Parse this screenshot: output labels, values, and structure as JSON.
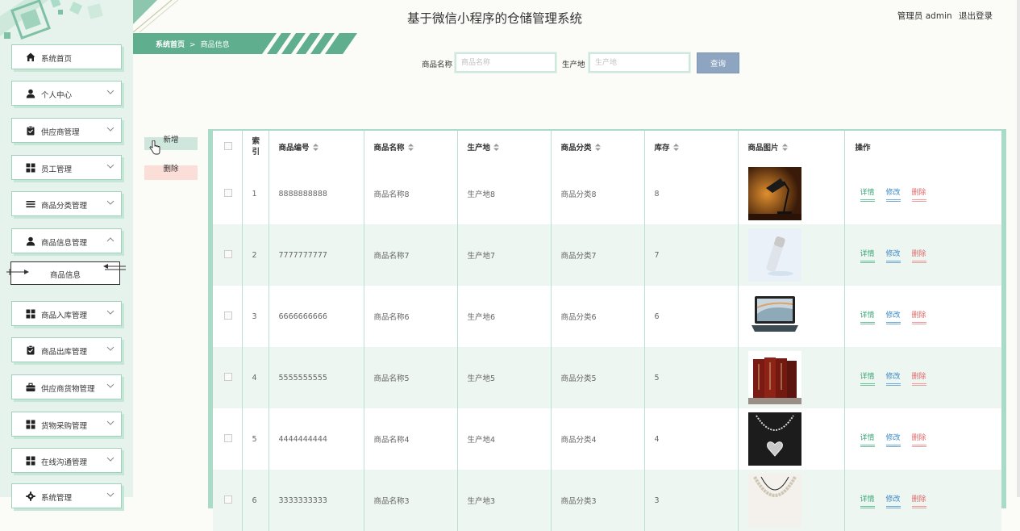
{
  "app": {
    "title": "基于微信小程序的仓储管理系统",
    "user_label": "管理员 admin",
    "logout_label": "退出登录"
  },
  "breadcrumb": {
    "home": "系统首页",
    "separator": ">",
    "current": "商品信息"
  },
  "sidebar": {
    "items": [
      {
        "label": "系统首页",
        "icon": "home-icon"
      },
      {
        "label": "个人中心",
        "icon": "user-icon"
      },
      {
        "label": "供应商管理",
        "icon": "clipboard-icon"
      },
      {
        "label": "员工管理",
        "icon": "grid-icon"
      },
      {
        "label": "商品分类管理",
        "icon": "list-icon"
      },
      {
        "label": "商品信息管理",
        "icon": "user-icon"
      },
      {
        "label": "商品入库管理",
        "icon": "grid-icon"
      },
      {
        "label": "商品出库管理",
        "icon": "clipboard-icon"
      },
      {
        "label": "供应商货物管理",
        "icon": "briefcase-icon"
      },
      {
        "label": "货物采购管理",
        "icon": "grid-icon"
      },
      {
        "label": "在线沟通管理",
        "icon": "grid-icon"
      },
      {
        "label": "系统管理",
        "icon": "gear-icon"
      }
    ],
    "subitem": {
      "label": "商品信息"
    }
  },
  "search": {
    "name_label": "商品名称",
    "name_placeholder": "商品名称",
    "origin_label": "生产地",
    "origin_placeholder": "生产地",
    "button_label": "查询"
  },
  "actions": {
    "add_label": "新增",
    "delete_label": "删除"
  },
  "table": {
    "headers": {
      "index": "索引",
      "code": "商品编号",
      "name": "商品名称",
      "origin": "生产地",
      "category": "商品分类",
      "stock": "库存",
      "image": "商品图片",
      "ops": "操作"
    },
    "row_actions": {
      "detail": "详情",
      "edit": "修改",
      "delete": "删除"
    },
    "rows": [
      {
        "index": "1",
        "code": "8888888888",
        "name": "商品名称8",
        "origin": "生产地8",
        "category": "商品分类8",
        "stock": "8",
        "image": "desk-lamp"
      },
      {
        "index": "2",
        "code": "7777777777",
        "name": "商品名称7",
        "origin": "生产地7",
        "category": "商品分类7",
        "stock": "7",
        "image": "cosmetic-bottle"
      },
      {
        "index": "3",
        "code": "6666666666",
        "name": "商品名称6",
        "origin": "生产地6",
        "category": "商品分类6",
        "stock": "6",
        "image": "laptop"
      },
      {
        "index": "4",
        "code": "5555555555",
        "name": "商品名称5",
        "origin": "生产地5",
        "category": "商品分类5",
        "stock": "5",
        "image": "book-set"
      },
      {
        "index": "5",
        "code": "4444444444",
        "name": "商品名称4",
        "origin": "生产地4",
        "category": "商品分类4",
        "stock": "4",
        "image": "heart-necklace"
      },
      {
        "index": "6",
        "code": "3333333333",
        "name": "商品名称3",
        "origin": "生产地3",
        "category": "商品分类3",
        "stock": "3",
        "image": "pearl-necklace"
      }
    ]
  },
  "colors": {
    "accent": "#5aae8e",
    "sidebar_bg": "#e6f3ec",
    "search_button": "#8da5c0",
    "detail": "#3fa577",
    "edit": "#3a87c4",
    "delete": "#e06a6a"
  }
}
